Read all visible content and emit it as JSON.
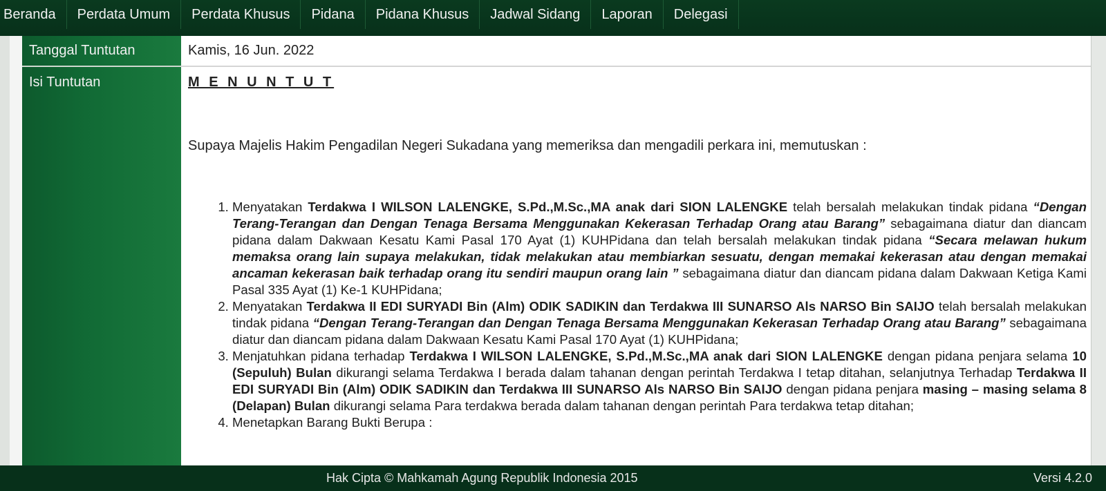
{
  "nav": {
    "items": [
      "Beranda",
      "Perdata Umum",
      "Perdata Khusus",
      "Pidana",
      "Pidana Khusus",
      "Jadwal Sidang",
      "Laporan",
      "Delegasi"
    ]
  },
  "labels": {
    "tanggal": "Tanggal Tuntutan",
    "isi": "Isi Tuntutan"
  },
  "content": {
    "date": "Kamis, 16 Jun. 2022",
    "heading": "M E N U N T U T",
    "intro": "Supaya Majelis Hakim Pengadilan Negeri Sukadana yang memeriksa dan mengadili perkara ini,  memutuskan  :",
    "items": [
      [
        {
          "t": "Menyatakan  "
        },
        {
          "t": "Terdakwa I WILSON LALENGKE, S.Pd.,M.Sc.,MA anak dari SION LALENGKE",
          "b": true
        },
        {
          "t": " telah bersalah melakukan tindak pidana  "
        },
        {
          "t": "“Dengan Terang-Terangan dan Dengan Tenaga Bersama Menggunakan Kekerasan Terhadap Orang atau Barang”",
          "b": true,
          "i": true
        },
        {
          "t": " sebagaimana diatur dan diancam pidana dalam Dakwaan  Kesatu Kami Pasal 170 Ayat (1) KUHPidana dan telah bersalah melakukan tindak pidana  "
        },
        {
          "t": "“Secara melawan hukum memaksa orang lain supaya melakukan, tidak melakukan atau membiarkan sesuatu, dengan memakai kekerasan atau dengan memakai ancaman kekerasan baik terhadap orang itu sendiri maupun orang lain ”",
          "b": true,
          "i": true
        },
        {
          "t": " sebagaimana diatur dan diancam  pidana dalam Dakwaan Ketiga Kami Pasal 335 Ayat (1) Ke-1 KUHPidana;"
        }
      ],
      [
        {
          "t": "Menyatakan "
        },
        {
          "t": "Terdakwa II EDI SURYADI  Bin (Alm) ODIK SADIKIN dan Terdakwa III SUNARSO Als NARSO Bin SAIJO",
          "b": true
        },
        {
          "t": " telah bersalah melakukan tindak pidana  "
        },
        {
          "t": "“Dengan Terang-Terangan dan Dengan Tenaga Bersama Menggunakan Kekerasan Terhadap Orang atau Barang”",
          "b": true,
          "i": true
        },
        {
          "t": " sebagaimana diatur dan diancam pidana dalam Dakwaan Kesatu Kami Pasal 170 Ayat (1) KUHPidana;"
        }
      ],
      [
        {
          "t": "Menjatuhkan pidana terhadap "
        },
        {
          "t": "Terdakwa I WILSON LALENGKE, S.Pd.,M.Sc.,MA anak dari SION LALENGKE",
          "b": true
        },
        {
          "t": " dengan pidana penjara selama "
        },
        {
          "t": "10 (Sepuluh) Bulan",
          "b": true
        },
        {
          "t": " dikurangi selama Terdakwa I berada dalam tahanan dengan perintah Terdakwa I tetap ditahan, selanjutnya Terhadap "
        },
        {
          "t": "Terdakwa II EDI SURYADI  Bin (Alm) ODIK SADIKIN dan Terdakwa III SUNARSO Als NARSO Bin SAIJO",
          "b": true
        },
        {
          "t": " dengan pidana penjara "
        },
        {
          "t": "masing – masing selama 8 (Delapan) Bulan",
          "b": true
        },
        {
          "t": " dikurangi selama Para terdakwa berada dalam tahanan dengan perintah Para terdakwa tetap ditahan;"
        }
      ],
      [
        {
          "t": "Menetapkan Barang Bukti Berupa :"
        }
      ]
    ]
  },
  "footer": {
    "copyright": "Hak Cipta © Mahkamah Agung Republik Indonesia 2015",
    "version": "Versi 4.2.0"
  },
  "colors": {
    "nav_bg": "#07301a",
    "label_green": "#116a35",
    "footer_bg": "#07301a"
  }
}
